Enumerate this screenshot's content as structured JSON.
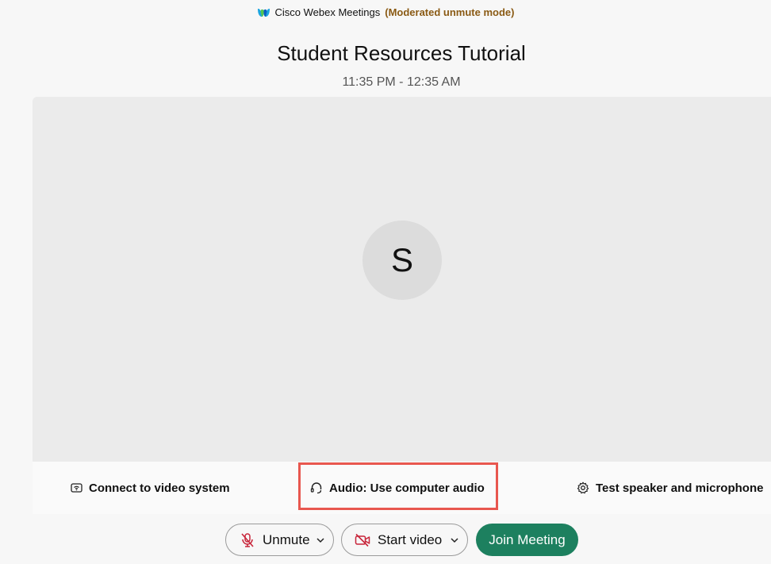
{
  "app": {
    "name": "Cisco Webex Meetings",
    "mode": "(Moderated unmute mode)"
  },
  "meeting": {
    "title": "Student Resources Tutorial",
    "time": "11:35 PM - 12:35 AM"
  },
  "avatar": {
    "initial": "S"
  },
  "options": {
    "video_system": "Connect to video system",
    "audio": "Audio: Use computer audio",
    "test": "Test speaker and microphone"
  },
  "controls": {
    "unmute": "Unmute",
    "start_video": "Start video",
    "join": "Join Meeting"
  },
  "colors": {
    "join": "#1d805f",
    "highlight": "#e8574f",
    "mute_icon": "#c8253a",
    "mode_text": "#8a5a14"
  },
  "icons": {
    "logo": "webex-logo-icon",
    "video_system": "screen-cast-icon",
    "audio": "headset-icon",
    "test": "gear-icon",
    "mute": "microphone-muted-icon",
    "video_off": "camera-off-icon",
    "chevron": "chevron-down-icon"
  }
}
